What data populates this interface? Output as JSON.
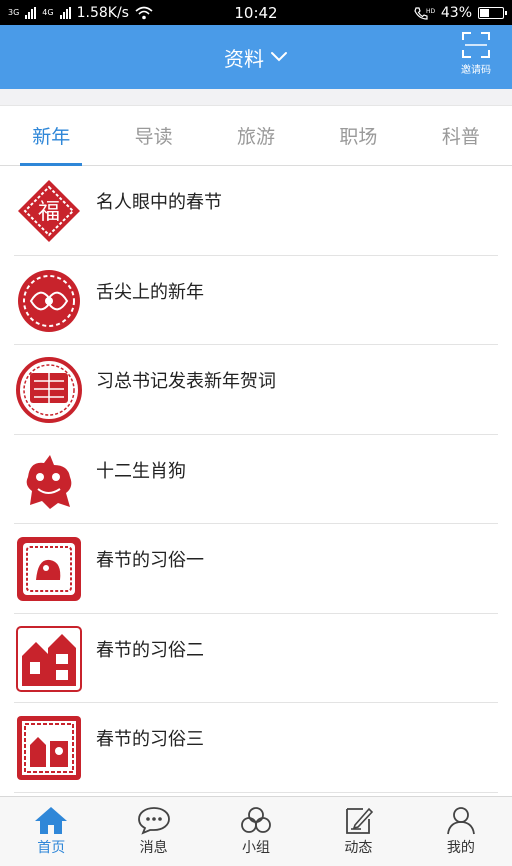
{
  "status_bar": {
    "network_left": "3G",
    "network_right": "4G",
    "speed": "1.58K/s",
    "time": "10:42",
    "battery": "43%",
    "battery_level": 0.43
  },
  "header": {
    "title": "资料",
    "invite_label": "邀请码"
  },
  "tabs": [
    {
      "label": "新年",
      "active": true
    },
    {
      "label": "导读",
      "active": false
    },
    {
      "label": "旅游",
      "active": false
    },
    {
      "label": "职场",
      "active": false
    },
    {
      "label": "科普",
      "active": false
    }
  ],
  "articles": [
    {
      "title": "名人眼中的春节",
      "thumb_icon": "fu-diamond-papercut-icon"
    },
    {
      "title": "舌尖上的新年",
      "thumb_icon": "round-papercut-icon"
    },
    {
      "title": "习总书记发表新年贺词",
      "thumb_icon": "new-year-seal-icon"
    },
    {
      "title": "十二生肖狗",
      "thumb_icon": "dog-papercut-icon"
    },
    {
      "title": "春节的习俗一",
      "thumb_icon": "square-papercut-icon"
    },
    {
      "title": "春节的习俗二",
      "thumb_icon": "building-papercut-icon"
    },
    {
      "title": "春节的习俗三",
      "thumb_icon": "scene-papercut-icon"
    }
  ],
  "bottom_nav": [
    {
      "label": "首页",
      "icon": "home-icon",
      "active": true
    },
    {
      "label": "消息",
      "icon": "chat-bubble-icon",
      "active": false
    },
    {
      "label": "小组",
      "icon": "group-circles-icon",
      "active": false
    },
    {
      "label": "动态",
      "icon": "edit-note-icon",
      "active": false
    },
    {
      "label": "我的",
      "icon": "person-icon",
      "active": false
    }
  ],
  "colors": {
    "primary": "#4a9be8",
    "active_tab": "#2f87d8",
    "papercut_red": "#c8232c"
  }
}
